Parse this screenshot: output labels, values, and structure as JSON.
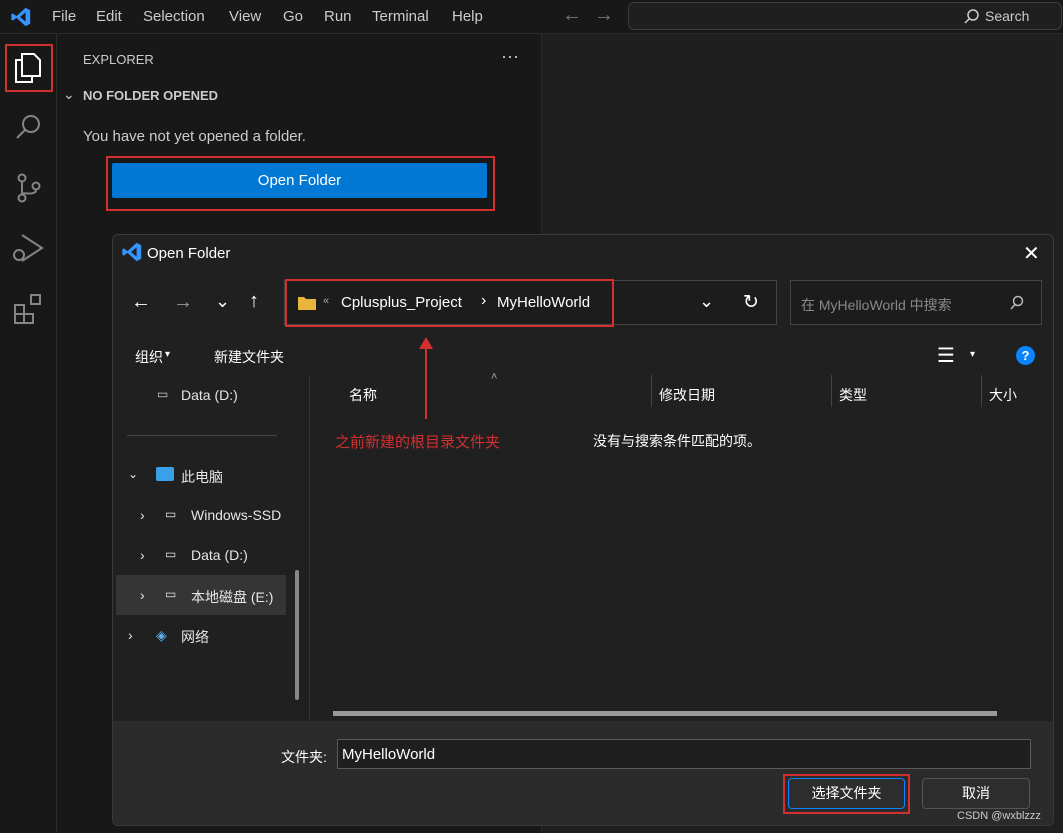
{
  "menu": [
    "File",
    "Edit",
    "Selection",
    "View",
    "Go",
    "Run",
    "Terminal",
    "Help"
  ],
  "search_placeholder": "Search",
  "sidebar": {
    "title": "EXPLORER",
    "section": "NO FOLDER OPENED",
    "message": "You have not yet opened a folder.",
    "open_folder": "Open Folder"
  },
  "dialog": {
    "title": "Open Folder",
    "breadcrumb": [
      "Cplusplus_Project",
      "MyHelloWorld"
    ],
    "search_placeholder": "在 MyHelloWorld 中搜索",
    "toolbar": {
      "organize": "组织",
      "new_folder": "新建文件夹"
    },
    "tree": [
      "Data (D:)",
      "此电脑",
      "Windows-SSD",
      "Data (D:)",
      "本地磁盘 (E:)",
      "网络"
    ],
    "columns": [
      "名称",
      "修改日期",
      "类型",
      "大小"
    ],
    "empty": "没有与搜索条件匹配的项。",
    "annotation": "之前新建的根目录文件夹",
    "folder_label": "文件夹:",
    "folder_value": "MyHelloWorld",
    "select_btn": "选择文件夹",
    "cancel_btn": "取消"
  },
  "watermark": "CSDN @wxblzzz",
  "colors": {
    "accent": "#0078d4",
    "annotation": "#d32f2f"
  }
}
